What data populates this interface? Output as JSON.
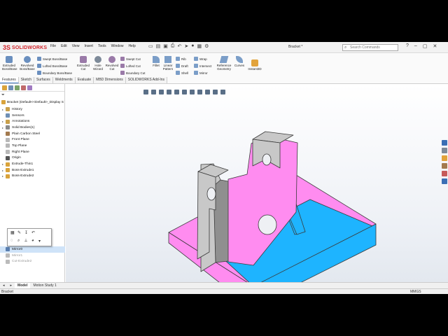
{
  "app": {
    "brand": "SOLIDWORKS",
    "document_title": "Bracket *",
    "search_placeholder": "Search Commands"
  },
  "menu": [
    "File",
    "Edit",
    "View",
    "Insert",
    "Tools",
    "Window",
    "Help"
  ],
  "ribbon": {
    "tools": [
      {
        "label": "Extruded\nBoss/Base",
        "color": "#6a8fbf"
      },
      {
        "label": "Revolved\nBoss/Base",
        "color": "#6a8fbf"
      },
      {
        "label": "Extruded\nCut",
        "color": "#9a7aa8"
      },
      {
        "label": "Hole\nWizard",
        "color": "#7d8a99"
      },
      {
        "label": "Revolved\nCut",
        "color": "#9a7aa8"
      },
      {
        "label": "Fillet",
        "color": "#7b9ec8"
      },
      {
        "label": "Linear\nPattern",
        "color": "#7b9ec8"
      },
      {
        "label": "Reference\nGeometry",
        "color": "#7b9ec8"
      },
      {
        "label": "Curves",
        "color": "#7b9ec8"
      },
      {
        "label": "Instant3D",
        "color": "#e2a33b"
      }
    ],
    "small_tools": [
      {
        "label": "Swept Boss/Base",
        "color": "#6a8fbf"
      },
      {
        "label": "Lofted Boss/Base",
        "color": "#6a8fbf"
      },
      {
        "label": "Boundary Boss/Base",
        "color": "#6a8fbf"
      },
      {
        "label": "Swept Cut",
        "color": "#9a7aa8"
      },
      {
        "label": "Lofted Cut",
        "color": "#9a7aa8"
      },
      {
        "label": "Boundary Cut",
        "color": "#9a7aa8"
      },
      {
        "label": "Rib",
        "color": "#7b9ec8"
      },
      {
        "label": "Draft",
        "color": "#7b9ec8"
      },
      {
        "label": "Shell",
        "color": "#7b9ec8"
      },
      {
        "label": "Wrap",
        "color": "#7b9ec8"
      },
      {
        "label": "Intersect",
        "color": "#7b9ec8"
      },
      {
        "label": "Mirror",
        "color": "#7b9ec8"
      }
    ]
  },
  "command_tabs": [
    "Features",
    "Sketch",
    "Surfaces",
    "Weldments",
    "Evaluate",
    "MBD Dimensions",
    "SOLIDWORKS Add-Ins"
  ],
  "feature_manager": {
    "root": "Bracket (Default<<Default>_Display S",
    "items": [
      {
        "label": "History",
        "icon": "history-icon",
        "color": "#c9a04a",
        "expand": "▸"
      },
      {
        "label": "Sensors",
        "icon": "sensor-icon",
        "color": "#6f8fb5",
        "expand": ""
      },
      {
        "label": "Annotations",
        "icon": "annotation-icon",
        "color": "#c9a04a",
        "expand": "▸"
      },
      {
        "label": "Solid Bodies(1)",
        "icon": "solid-body-icon",
        "color": "#8a8a8a",
        "expand": "▸"
      },
      {
        "label": "Plain Carbon Steel",
        "icon": "material-icon",
        "color": "#a37a4e",
        "expand": ""
      },
      {
        "label": "Front Plane",
        "icon": "plane-icon",
        "color": "#b8b8b8",
        "expand": ""
      },
      {
        "label": "Top Plane",
        "icon": "plane-icon",
        "color": "#b8b8b8",
        "expand": ""
      },
      {
        "label": "Right Plane",
        "icon": "plane-icon",
        "color": "#b8b8b8",
        "expand": ""
      },
      {
        "label": "Origin",
        "icon": "origin-icon",
        "color": "#555555",
        "expand": ""
      },
      {
        "label": "Extrude-Thin1",
        "icon": "extrude-icon",
        "color": "#d9a33b",
        "expand": "▸"
      },
      {
        "label": "Boss-Extrude1",
        "icon": "extrude-icon",
        "color": "#d9a33b",
        "expand": "▸"
      },
      {
        "label": "Boss-Extrude2",
        "icon": "extrude-icon",
        "color": "#d9a33b",
        "expand": "▸"
      }
    ],
    "lower_items": [
      {
        "label": "Mirror0",
        "icon": "mirror-icon",
        "color": "#5a7fb0",
        "state": "sel"
      },
      {
        "label": "Mirror1",
        "icon": "mirror-icon",
        "color": "#bbbbbb",
        "state": "suppr"
      },
      {
        "label": "Cut-Extrude2",
        "icon": "cut-icon",
        "color": "#bbbbbb",
        "state": "suppr"
      }
    ]
  },
  "model": {
    "face_pink": "#ff8cf0",
    "face_blue": "#1eb4ff",
    "face_grey": "#c8c8c8",
    "face_dark": "#8f8f8f",
    "edge": "#3a3a3a"
  },
  "bottom_tabs": [
    "Model",
    "Motion Study 1"
  ],
  "status": {
    "left": "Bracket",
    "units": "MMGS"
  }
}
